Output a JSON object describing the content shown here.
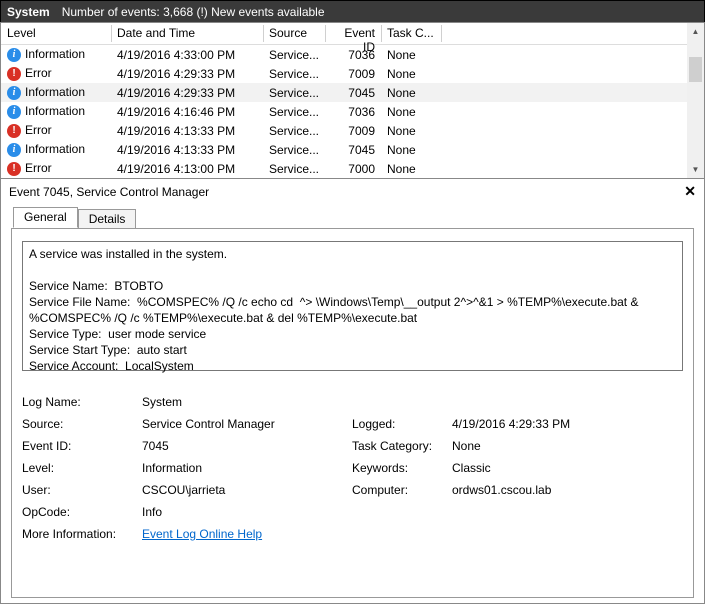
{
  "titlebar": {
    "title": "System",
    "subtitle": "Number of events: 3,668 (!) New events available"
  },
  "columns": {
    "level": "Level",
    "datetime": "Date and Time",
    "source": "Source",
    "eventid": "Event ID",
    "task": "Task C..."
  },
  "scroll": {
    "up": "▲",
    "down": "▼"
  },
  "rows": [
    {
      "icon": "info",
      "level": "Information",
      "datetime": "4/19/2016 4:33:00 PM",
      "source": "Service...",
      "eventid": "7036",
      "task": "None",
      "sel": false
    },
    {
      "icon": "error",
      "level": "Error",
      "datetime": "4/19/2016 4:29:33 PM",
      "source": "Service...",
      "eventid": "7009",
      "task": "None",
      "sel": false
    },
    {
      "icon": "info",
      "level": "Information",
      "datetime": "4/19/2016 4:29:33 PM",
      "source": "Service...",
      "eventid": "7045",
      "task": "None",
      "sel": true
    },
    {
      "icon": "info",
      "level": "Information",
      "datetime": "4/19/2016 4:16:46 PM",
      "source": "Service...",
      "eventid": "7036",
      "task": "None",
      "sel": false
    },
    {
      "icon": "error",
      "level": "Error",
      "datetime": "4/19/2016 4:13:33 PM",
      "source": "Service...",
      "eventid": "7009",
      "task": "None",
      "sel": false
    },
    {
      "icon": "info",
      "level": "Information",
      "datetime": "4/19/2016 4:13:33 PM",
      "source": "Service...",
      "eventid": "7045",
      "task": "None",
      "sel": false
    },
    {
      "icon": "error",
      "level": "Error",
      "datetime": "4/19/2016 4:13:00 PM",
      "source": "Service...",
      "eventid": "7000",
      "task": "None",
      "sel": false
    }
  ],
  "detail": {
    "header": "Event 7045, Service Control Manager",
    "close": "✕",
    "tabs": {
      "general": "General",
      "details": "Details"
    },
    "message": "A service was installed in the system.\n\nService Name:  BTOBTO\nService File Name:  %COMSPEC% /Q /c echo cd  ^> \\Windows\\Temp\\__output 2^>^&1 > %TEMP%\\execute.bat & %COMSPEC% /Q /c %TEMP%\\execute.bat & del %TEMP%\\execute.bat\nService Type:  user mode service\nService Start Type:  auto start\nService Account:  LocalSystem",
    "props": {
      "logname_l": "Log Name:",
      "logname_v": "System",
      "source_l": "Source:",
      "source_v": "Service Control Manager",
      "logged_l": "Logged:",
      "logged_v": "4/19/2016 4:29:33 PM",
      "eventid_l": "Event ID:",
      "eventid_v": "7045",
      "taskcat_l": "Task Category:",
      "taskcat_v": "None",
      "level_l": "Level:",
      "level_v": "Information",
      "keywords_l": "Keywords:",
      "keywords_v": "Classic",
      "user_l": "User:",
      "user_v": "CSCOU\\jarrieta",
      "computer_l": "Computer:",
      "computer_v": "ordws01.cscou.lab",
      "opcode_l": "OpCode:",
      "opcode_v": "Info",
      "moreinfo_l": "More Information:",
      "moreinfo_link": "Event Log Online Help"
    }
  }
}
